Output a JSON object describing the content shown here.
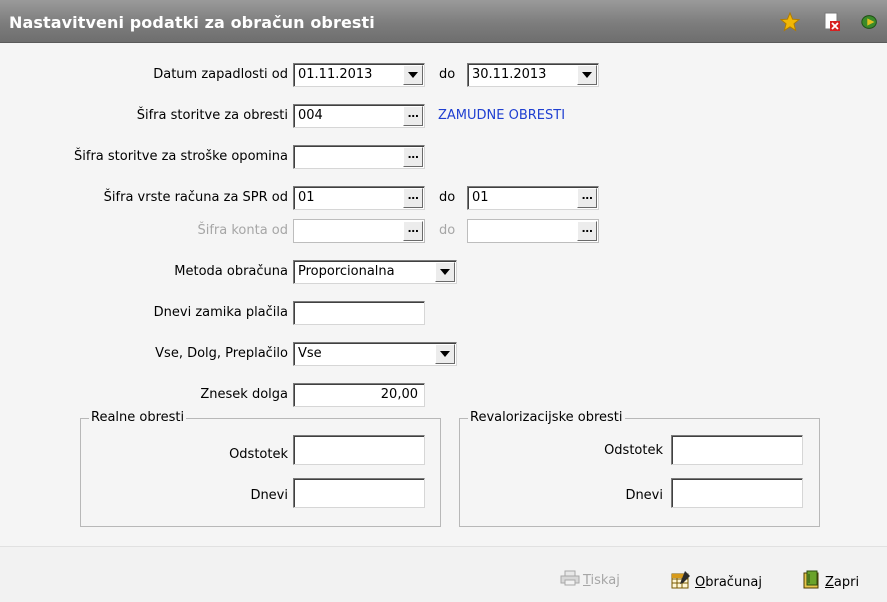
{
  "window": {
    "title": "Nastavitveni podatki za obračun obresti"
  },
  "form": {
    "datum_label": "Datum zapadlosti od",
    "datum_od": "01.11.2013",
    "do1": "do",
    "datum_do": "30.11.2013",
    "sifra_storitve_label": "Šifra storitve za obresti",
    "sifra_storitve_value": "004",
    "sifra_storitve_desc": "ZAMUDNE OBRESTI",
    "stroski_label": "Šifra storitve za stroške opomina",
    "stroski_value": "",
    "vrsta_label": "Šifra vrste računa za SPR od",
    "vrsta_od": "01",
    "do2": "do",
    "vrsta_do": "01",
    "konto_label": "Šifra konta od",
    "konto_od": "",
    "do3": "do",
    "konto_do": "",
    "metoda_label": "Metoda obračuna",
    "metoda_value": "Proporcionalna",
    "dnevi_zamika_label": "Dnevi zamika plačila",
    "dnevi_zamika_value": "",
    "vse_label": "Vse, Dolg, Preplačilo",
    "vse_value": "Vse",
    "znesek_label": "Znesek dolga",
    "znesek_value": "20,00"
  },
  "realne": {
    "legend": "Realne obresti",
    "odstotek_label": "Odstotek",
    "odstotek_value": "",
    "dnevi_label": "Dnevi",
    "dnevi_value": ""
  },
  "revalorizacijske": {
    "legend": "Revalorizacijske obresti",
    "odstotek_label": "Odstotek",
    "odstotek_value": "",
    "dnevi_label": "Dnevi",
    "dnevi_value": ""
  },
  "footer": {
    "tiskaj_first": "T",
    "tiskaj_rest": "iskaj",
    "obracunaj_first": "O",
    "obracunaj_rest": "bračunaj",
    "zapri_first": "Z",
    "zapri_rest": "apri"
  },
  "icons": {
    "favorite": "star-icon",
    "close_doc": "close-document-icon",
    "exit": "exit-icon",
    "print": "printer-icon",
    "calculate": "calculator-icon",
    "close": "close-book-icon"
  },
  "colors": {
    "accent_blue": "#1f3fd1",
    "titlebar": "#7d7d7d",
    "star": "#f2b705"
  }
}
